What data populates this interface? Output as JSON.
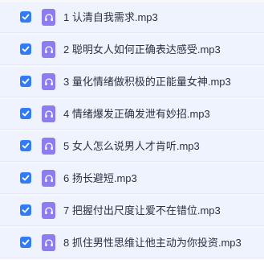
{
  "colors": {
    "accent": "#2f7cf6",
    "audio_icon": "#8c7cf0"
  },
  "files": [
    {
      "name": "1 认清自我需求.mp3",
      "checked": true,
      "icon": "headphones-icon"
    },
    {
      "name": "2 聪明女人如何正确表达感受.mp3",
      "checked": true,
      "icon": "headphones-icon"
    },
    {
      "name": "3 量化情绪做积极的正能量女神.mp3",
      "checked": true,
      "icon": "headphones-icon"
    },
    {
      "name": "4 情绪爆发正确发泄有妙招.mp3",
      "checked": true,
      "icon": "headphones-icon"
    },
    {
      "name": "5 女人怎么说男人才肯听.mp3",
      "checked": true,
      "icon": "headphones-icon"
    },
    {
      "name": "6 扬长避短.mp3",
      "checked": true,
      "icon": "headphones-icon"
    },
    {
      "name": "7 把握付出尺度让爱不在错位.mp3",
      "checked": true,
      "icon": "headphones-icon"
    },
    {
      "name": "8 抓住男性思维让他主动为你投资.mp3",
      "checked": true,
      "icon": "headphones-icon"
    }
  ]
}
